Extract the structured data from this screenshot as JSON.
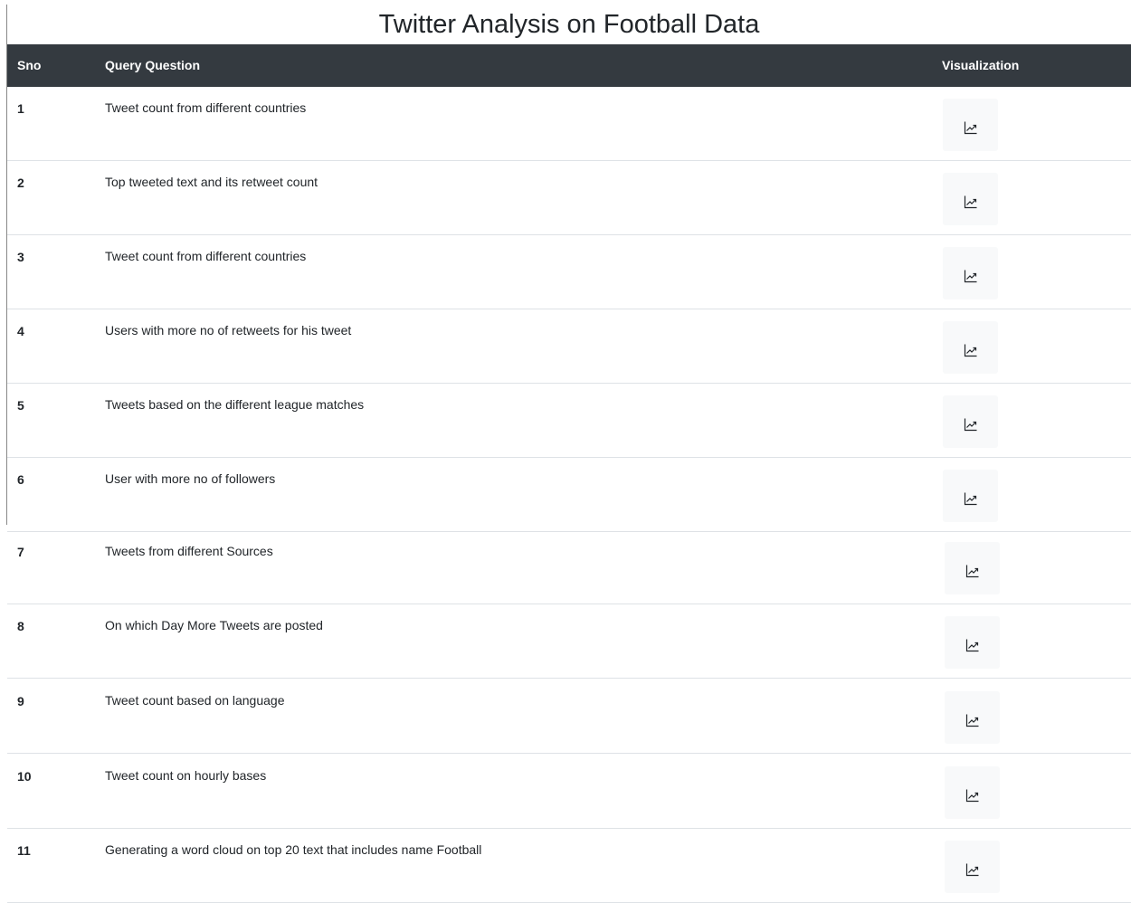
{
  "page": {
    "title": "Twitter Analysis on Football Data"
  },
  "table": {
    "headers": {
      "sno": "Sno",
      "query": "Query Question",
      "visualization": "Visualization"
    },
    "rows": [
      {
        "sno": "1",
        "question": "Tweet count from different countries",
        "icon": "chart-line-icon"
      },
      {
        "sno": "2",
        "question": "Top tweeted text and its retweet count",
        "icon": "chart-line-icon"
      },
      {
        "sno": "3",
        "question": "Tweet count from different countries",
        "icon": "chart-line-icon"
      },
      {
        "sno": "4",
        "question": "Users with more no of retweets for his tweet",
        "icon": "chart-line-icon"
      },
      {
        "sno": "5",
        "question": "Tweets based on the different league matches",
        "icon": "chart-line-icon"
      },
      {
        "sno": "6",
        "question": "User with more no of followers",
        "icon": "chart-line-icon"
      },
      {
        "sno": "7",
        "question": "Tweets from different Sources",
        "icon": "chart-line-icon"
      },
      {
        "sno": "8",
        "question": "On which Day More Tweets are posted",
        "icon": "chart-line-icon"
      },
      {
        "sno": "9",
        "question": "Tweet count based on language",
        "icon": "chart-line-icon"
      },
      {
        "sno": "10",
        "question": "Tweet count on hourly bases",
        "icon": "chart-line-icon"
      },
      {
        "sno": "11",
        "question": "Generating a word cloud on top 20 text that includes name Football",
        "icon": "chart-line-icon"
      }
    ]
  },
  "colors": {
    "header_bg": "#343a40",
    "button_bg": "#f8f9fa",
    "row_border": "#dee2e6"
  }
}
